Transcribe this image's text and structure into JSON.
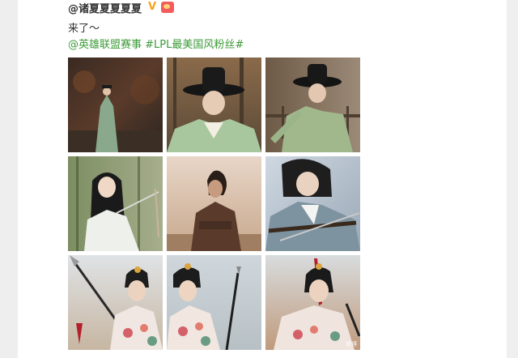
{
  "post": {
    "author": "@诸夏夏夏夏夏",
    "vip_badge": "V",
    "text": "来了～",
    "topics": [
      "@英雄联盟赛事",
      "#LPL最美国风粉丝#"
    ]
  },
  "photos": [
    {
      "label": "photo-1",
      "desc": "figure in green robe standing in dark autumn forest"
    },
    {
      "label": "photo-2",
      "desc": "man in black wide-brim hat and green robe"
    },
    {
      "label": "photo-3",
      "desc": "man in black hat with raised arm near fence"
    },
    {
      "label": "photo-4",
      "desc": "long-haired swordsman in white robe with blade"
    },
    {
      "label": "photo-5",
      "desc": "figure in brown armor against misty sky"
    },
    {
      "label": "photo-6",
      "desc": "warrior in grey-blue robe holding sword"
    },
    {
      "label": "photo-7",
      "desc": "warrior with spear and floral robe"
    },
    {
      "label": "photo-8",
      "desc": "warrior with spear over shoulder, floral robe"
    },
    {
      "label": "photo-9",
      "desc": "warrior with red tassel and floral robe"
    }
  ],
  "watermark": "微博",
  "colors": {
    "topic_green": "#3b9a37",
    "vip_orange": "#f7a21b"
  }
}
